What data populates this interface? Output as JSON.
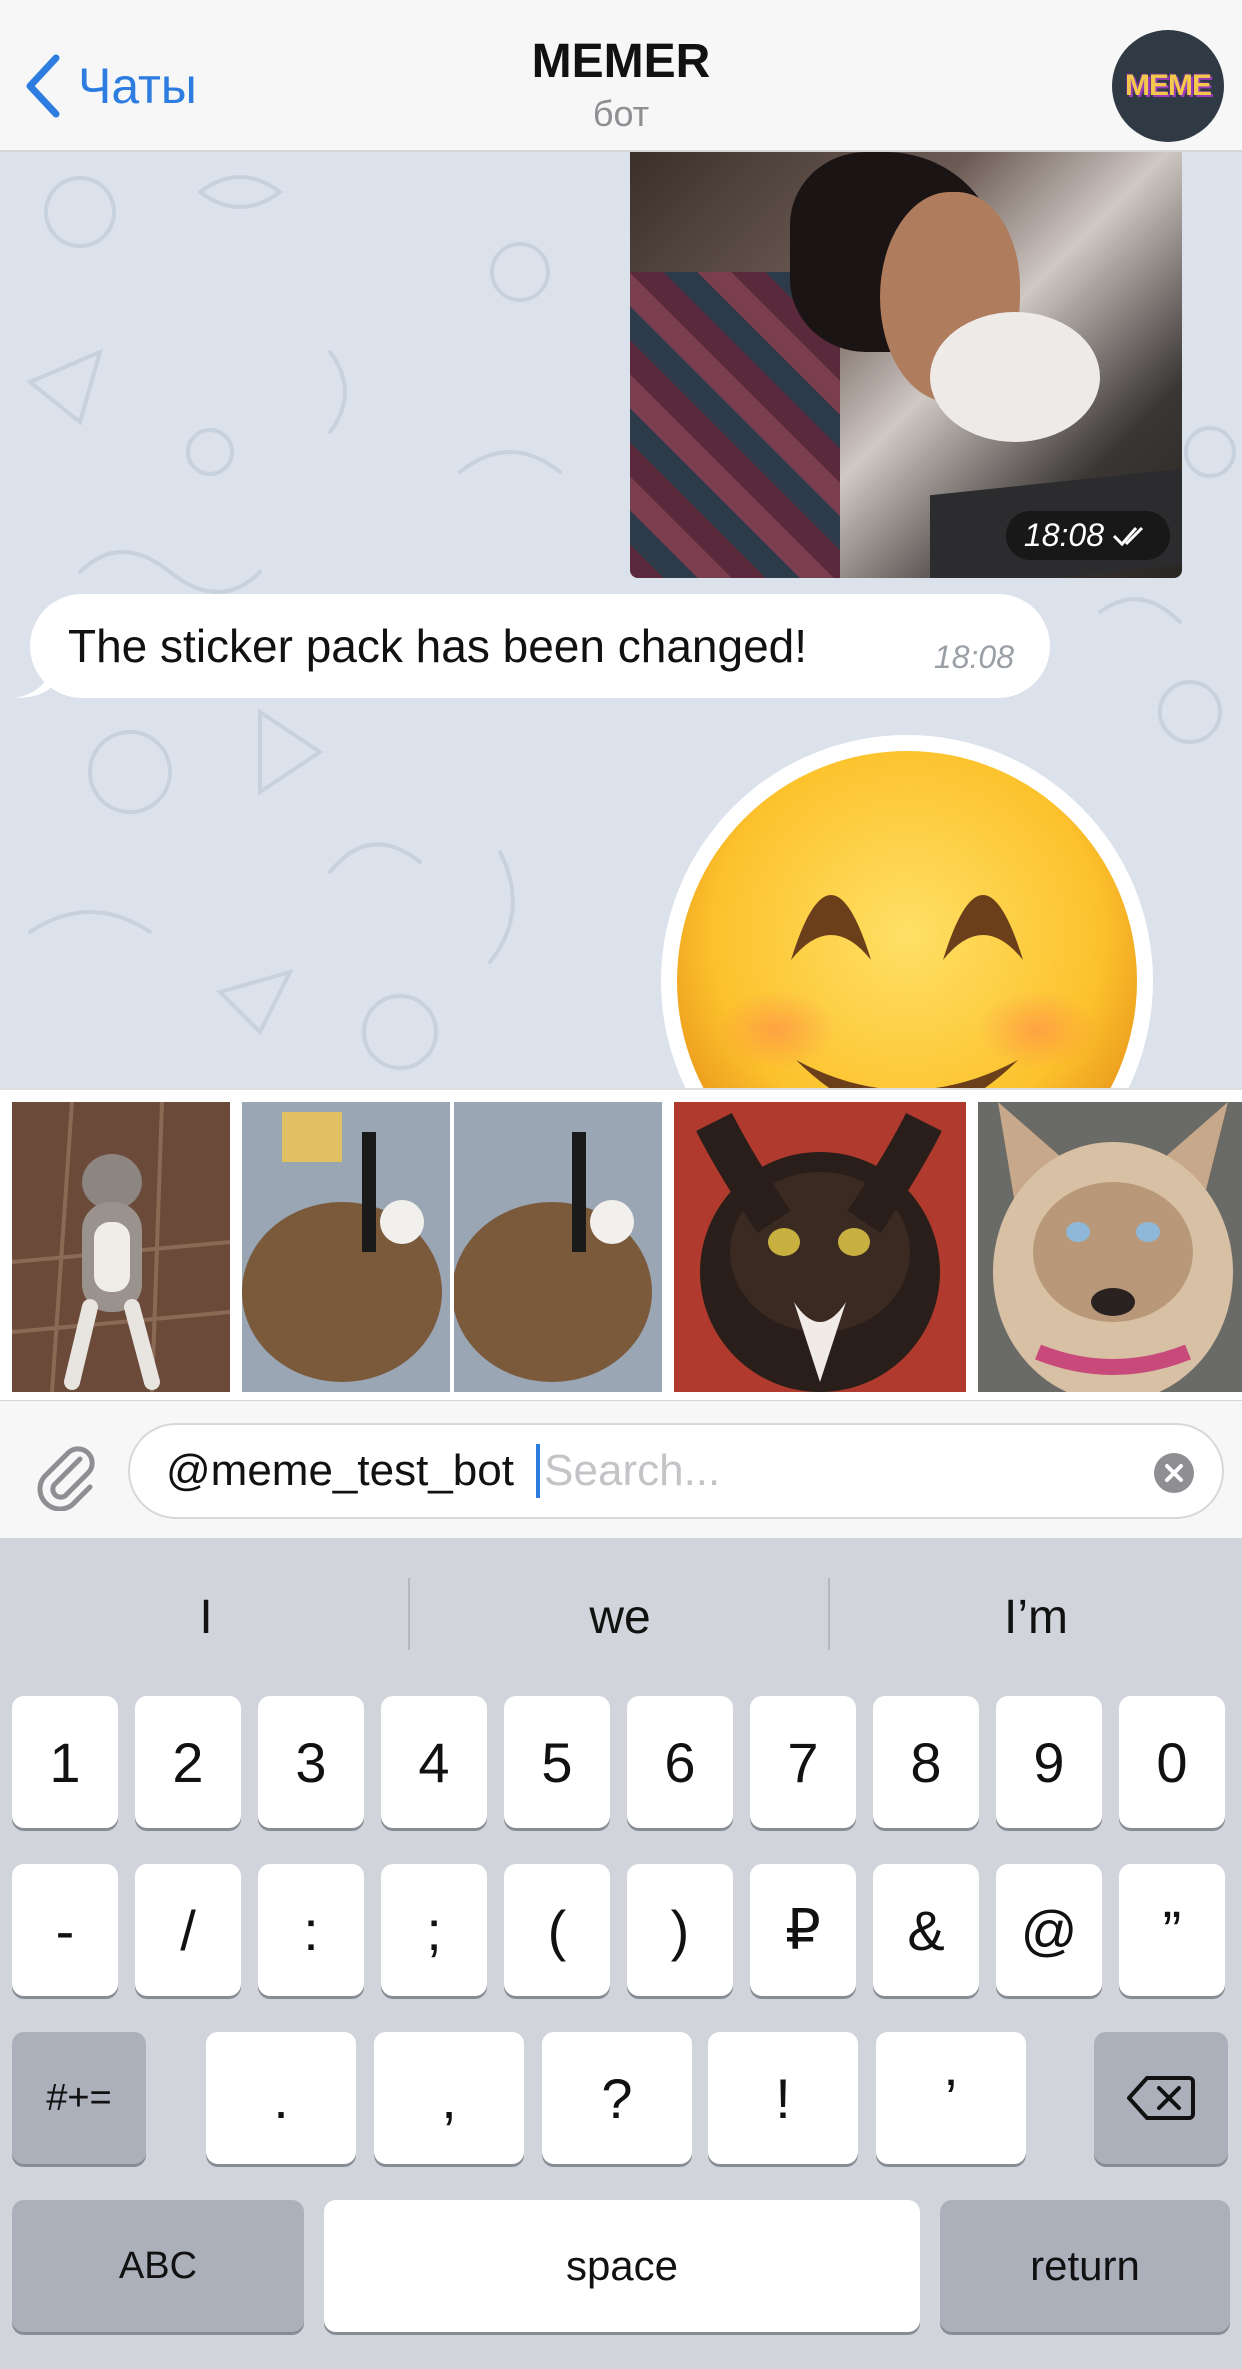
{
  "nav": {
    "back_label": "Чаты",
    "title": "MEMER",
    "subtitle": "бот",
    "avatar_text": "MEME"
  },
  "messages": [
    {
      "type": "photo",
      "time": "18:08",
      "status": "read-double-check"
    },
    {
      "type": "text",
      "text": "The sticker pack has been changed!",
      "time": "18:08"
    },
    {
      "type": "sticker",
      "emoji": "smiling-face-emoji"
    }
  ],
  "results": [
    {
      "label": "cat-standing"
    },
    {
      "label": "cat-with-gun"
    },
    {
      "label": "calico-cat"
    },
    {
      "label": "husky-dog"
    }
  ],
  "input": {
    "bot_prefix": "@meme_test_bot ",
    "placeholder": "Search..."
  },
  "keyboard": {
    "suggestions": [
      "I",
      "we",
      "I’m"
    ],
    "row1": [
      "1",
      "2",
      "3",
      "4",
      "5",
      "6",
      "7",
      "8",
      "9",
      "0"
    ],
    "row2": [
      "-",
      "/",
      ":",
      ";",
      "(",
      ")",
      "₽",
      "&",
      "@",
      "”"
    ],
    "row3_toggle": "#+=",
    "row3": [
      ".",
      ",",
      "?",
      "!",
      "’"
    ],
    "abc": "ABC",
    "space": "space",
    "return": "return"
  },
  "colors": {
    "accent": "#2d7de0",
    "chat_background": "#dbe2ec",
    "keyboard_background": "#d1d4db"
  },
  "icons": [
    "chevron-left-icon",
    "paperclip-icon",
    "clear-icon",
    "backspace-icon",
    "double-check-icon"
  ]
}
